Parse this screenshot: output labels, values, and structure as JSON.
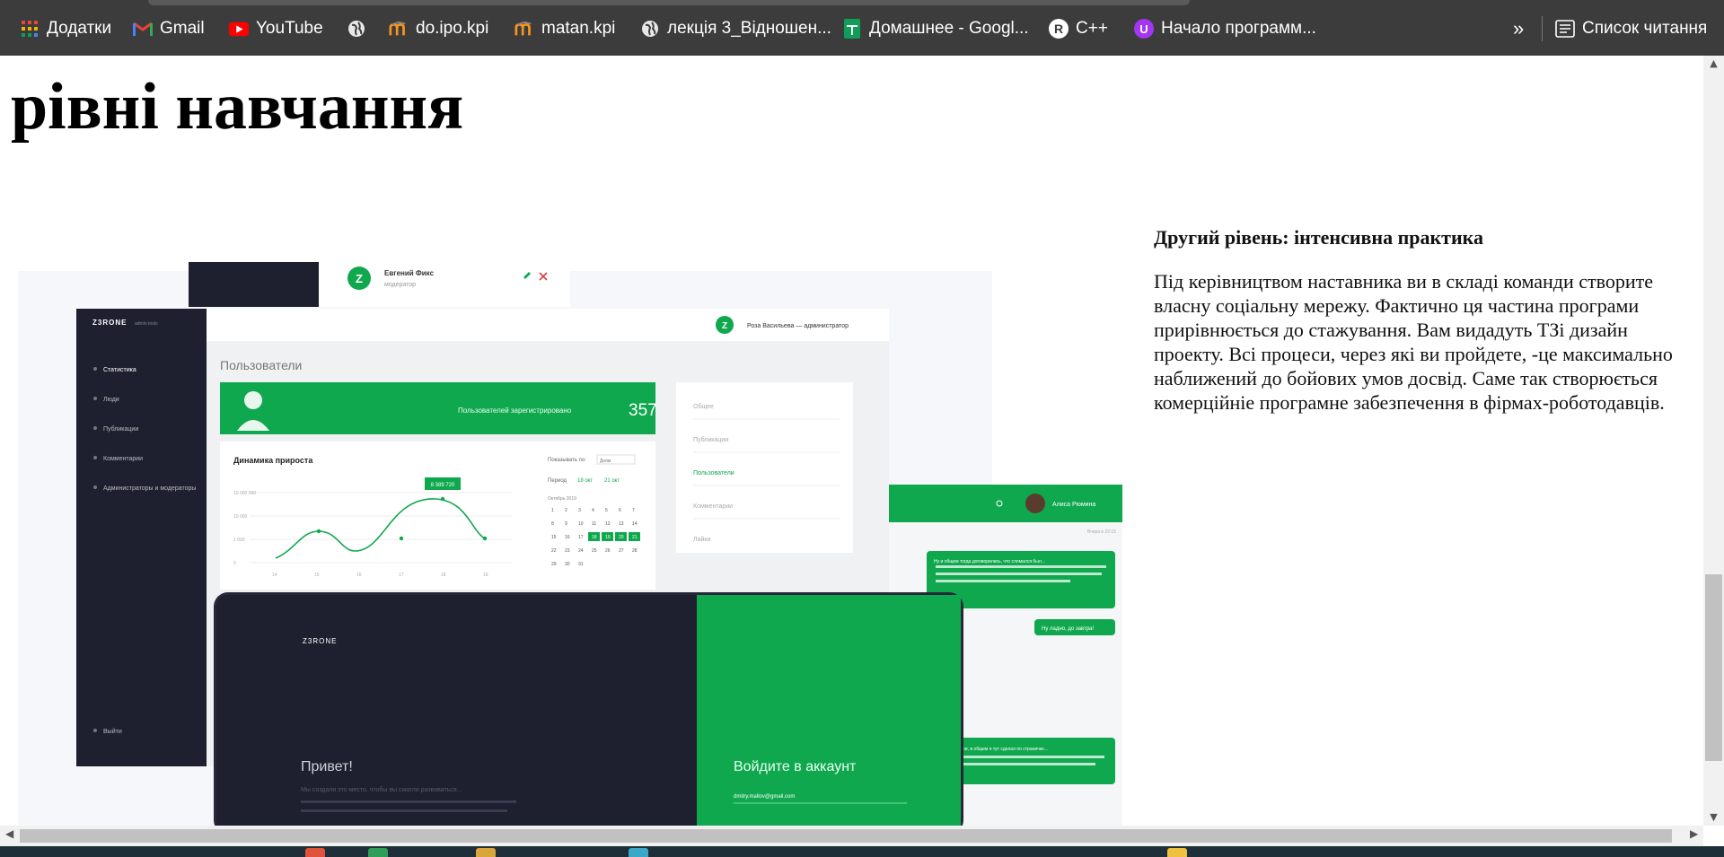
{
  "bookmarks": {
    "items": [
      {
        "label": "Додатки",
        "icon": "apps-grid-icon"
      },
      {
        "label": "Gmail",
        "icon": "gmail-icon"
      },
      {
        "label": "YouTube",
        "icon": "youtube-icon"
      },
      {
        "label": "",
        "icon": "globe-icon"
      },
      {
        "label": "do.ipo.kpi",
        "icon": "moodle-icon"
      },
      {
        "label": "matan.kpi",
        "icon": "moodle-icon"
      },
      {
        "label": "лекція 3_Відношен...",
        "icon": "globe-icon"
      },
      {
        "label": "Домашнее - Googl...",
        "icon": "google-sheets-icon"
      },
      {
        "label": "C++",
        "icon": "r-badge-icon"
      },
      {
        "label": "Начало программ...",
        "icon": "u-badge-icon"
      }
    ],
    "overflow_label": "»",
    "reading_list_label": "Список читання"
  },
  "page": {
    "heading": "рівні навчання",
    "section_title": "Другий рівень: інтенсивна практика",
    "section_text": "Під керівництвом наставника ви в складі команди створите власну соціальну мережу. Фактично ця частина програми прирівнюється до стажування. Вам видадуть ТЗі дизайн проекту. Всі процеси, через які ви пройдете, -це максимально наближений до бойових умов досвід. Саме так створюється комерційніе програмне забезпечення в фірмах-роботодавців."
  },
  "mockup": {
    "brand": "Z3RONE",
    "brand_sub": "admin tools",
    "admin_user": "Роза Васильева — администратор",
    "moderator_name": "Евгений Фикс",
    "moderator_role": "модератор",
    "users_title": "Пользователи",
    "registered_label": "Пользователей зарегистрировано",
    "registered_count": "357",
    "growth_title": "Динамика прироста",
    "growth_yticks": [
      "10 000 000",
      "10 000",
      "1 000",
      "0"
    ],
    "growth_xticks": [
      "14",
      "15",
      "16",
      "17",
      "18",
      "19"
    ],
    "growth_badge": "8 389 720",
    "show_by_label": "Показывать по:",
    "show_by_value": "Дням",
    "period_label": "Период",
    "period_from": "18 окт",
    "period_to": "21 окт",
    "calendar_month": "Октябрь 2019",
    "menu_items": [
      "Статистика",
      "Люди",
      "Публикации",
      "Комментарии",
      "Администраторы и модераторы"
    ],
    "logout_label": "Выйти",
    "filter_items": [
      "Общее",
      "Публикации",
      "Пользователи",
      "Комментарии",
      "Лайки"
    ],
    "chat_user": "Алиса Рюмина",
    "chat_time": "Вчера в 22:15",
    "chat_msg1": "Ну и общем тогда договорились, что сломался был...",
    "chat_msg2": "Ну ладно, до завтра!",
    "chat_msg3": "Смотри, в общем я тут сделал по страничке...",
    "login_greeting": "Привет!",
    "login_text": "Мы создали это место, чтобы вы смогли развиваться...",
    "login_title": "Войдите в аккаунт",
    "login_email": "dmitry.mallov@gmail.com"
  },
  "colors": {
    "accent_green": "#10a84e",
    "dark_navy": "#1e2030",
    "bookmark_bar": "#3c3c3c"
  }
}
